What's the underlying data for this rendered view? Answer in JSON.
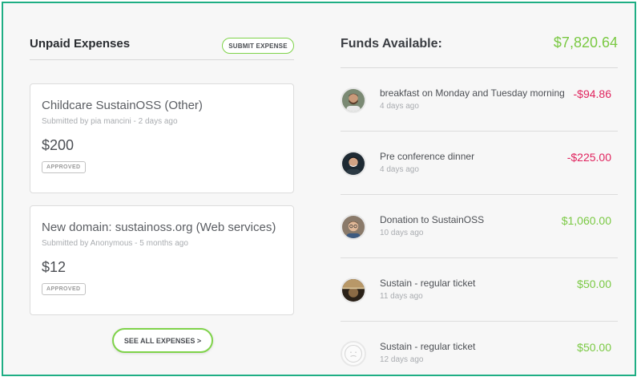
{
  "unpaid": {
    "title": "Unpaid Expenses",
    "submit_label": "SUBMIT EXPENSE",
    "see_all_label": "SEE ALL EXPENSES >",
    "expenses": [
      {
        "title": "Childcare SustainOSS (Other)",
        "submitted": "Submitted by pia mancini - 2 days ago",
        "amount": "$200",
        "status": "APPROVED"
      },
      {
        "title": "New domain: sustainoss.org (Web services)",
        "submitted": "Submitted by Anonymous - 5 months ago",
        "amount": "$12",
        "status": "APPROVED"
      }
    ]
  },
  "funds": {
    "label": "Funds Available:",
    "value": "$7,820.64",
    "transactions": [
      {
        "description": "breakfast on Monday and Tuesday morning",
        "date": "4 days ago",
        "amount": "-$94.86",
        "kind": "negative",
        "avatar": "user-avatar-man-beard"
      },
      {
        "description": "Pre conference dinner",
        "date": "4 days ago",
        "amount": "-$225.00",
        "kind": "negative",
        "avatar": "user-avatar-man-dark-hair"
      },
      {
        "description": "Donation to SustainOSS",
        "date": "10 days ago",
        "amount": "$1,060.00",
        "kind": "positive",
        "avatar": "user-avatar-man-glasses"
      },
      {
        "description": "Sustain - regular ticket",
        "date": "11 days ago",
        "amount": "$50.00",
        "kind": "positive",
        "avatar": "user-avatar-brown"
      },
      {
        "description": "Sustain - regular ticket",
        "date": "12 days ago",
        "amount": "$50.00",
        "kind": "positive",
        "avatar": "default-avatar-icon"
      }
    ]
  },
  "colors": {
    "frame_border": "#1fae84",
    "accent_green": "#7ac943",
    "negative_red": "#e0245e"
  }
}
